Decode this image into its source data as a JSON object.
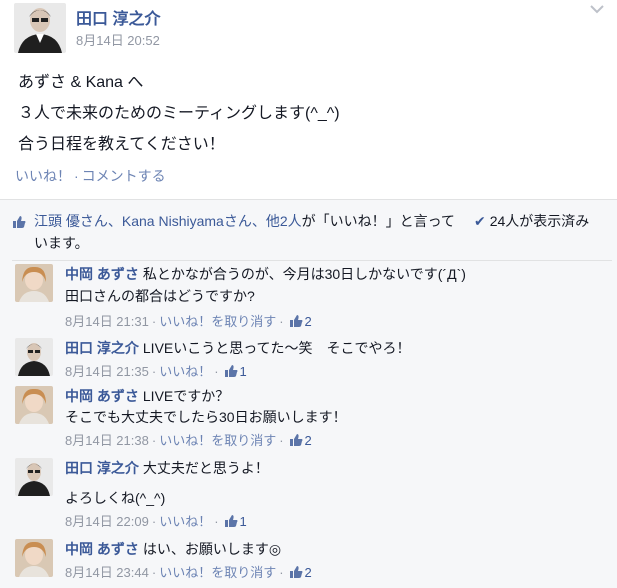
{
  "post": {
    "author": "田口 淳之介",
    "time": "8月14日 20:52",
    "lines": [
      "あずさ & Kana へ",
      "３人で未来のためのミーティングします(^_^)",
      "合う日程を教えてください！"
    ],
    "like_link": "いいね！",
    "separator": "·",
    "comment_link": "コメントする"
  },
  "likes": {
    "names": "江頭 優さん、Kana Nishiyamaさん、他2人",
    "suffix": "が「いいね！」と言っています。",
    "seen": "24人が表示済み"
  },
  "comments": [
    {
      "author": "中岡 あずさ",
      "line1": "私とかなが合うのが、今月は30日しかないです(´Д`)",
      "line2": "田口さんの都合はどうですか?",
      "time": "8月14日 21:31",
      "like_action": "いいね！を取り消す",
      "likes": "2"
    },
    {
      "author": "田口 淳之介",
      "line1": "LIVEいこうと思ってた〜笑　そこでやろ！",
      "time": "8月14日 21:35",
      "like_action": "いいね！",
      "likes": "1"
    },
    {
      "author": "中岡 あずさ",
      "line1": "LIVEですか？",
      "line2": "そこでも大丈夫でしたら30日お願いします！",
      "time": "8月14日 21:38",
      "like_action": "いいね！を取り消す",
      "likes": "2"
    },
    {
      "author": "田口 淳之介",
      "line1": "大丈夫だと思うよ！",
      "line2": "よろしくね(^_^)",
      "time": "8月14日 22:09",
      "like_action": "いいね！",
      "likes": "1"
    },
    {
      "author": "中岡 あずさ",
      "line1": "はい、お願いします◎",
      "time": "8月14日 23:44",
      "like_action": "いいね！を取り消す",
      "likes": "2"
    }
  ],
  "colors": {
    "link": "#3b5998",
    "muted": "#9197a3",
    "feedback_bg": "#f6f7f9"
  },
  "icons": [
    "like-thumb-icon",
    "check-icon",
    "chevron-down-icon"
  ]
}
